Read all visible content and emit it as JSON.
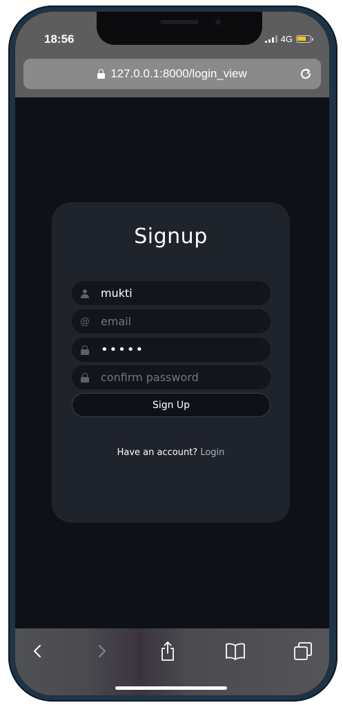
{
  "status_bar": {
    "time": "18:56",
    "network": "4G",
    "battery_color": "#f5c518",
    "battery_level": 0.7
  },
  "browser": {
    "url": "127.0.0.1:8000/login_view",
    "lock_icon": "lock-icon",
    "reload_icon": "reload-icon"
  },
  "form": {
    "title": "Signup",
    "username": {
      "value": "mukti",
      "icon": "user-icon"
    },
    "email": {
      "placeholder": "email",
      "icon": "at-icon"
    },
    "password": {
      "value": "•••••",
      "icon": "lock-icon"
    },
    "confirm_password": {
      "placeholder": "confirm password",
      "icon": "lock-icon"
    },
    "submit_label": "Sign Up",
    "have_account_text": "Have an account?",
    "login_link": "Login"
  },
  "toolbar": {
    "items": [
      "back-icon",
      "forward-icon",
      "share-icon",
      "bookmarks-icon",
      "tabs-icon"
    ]
  },
  "colors": {
    "page_bg": "#0e1117",
    "card_bg": "#1f232b",
    "field_bg": "#12151b"
  }
}
